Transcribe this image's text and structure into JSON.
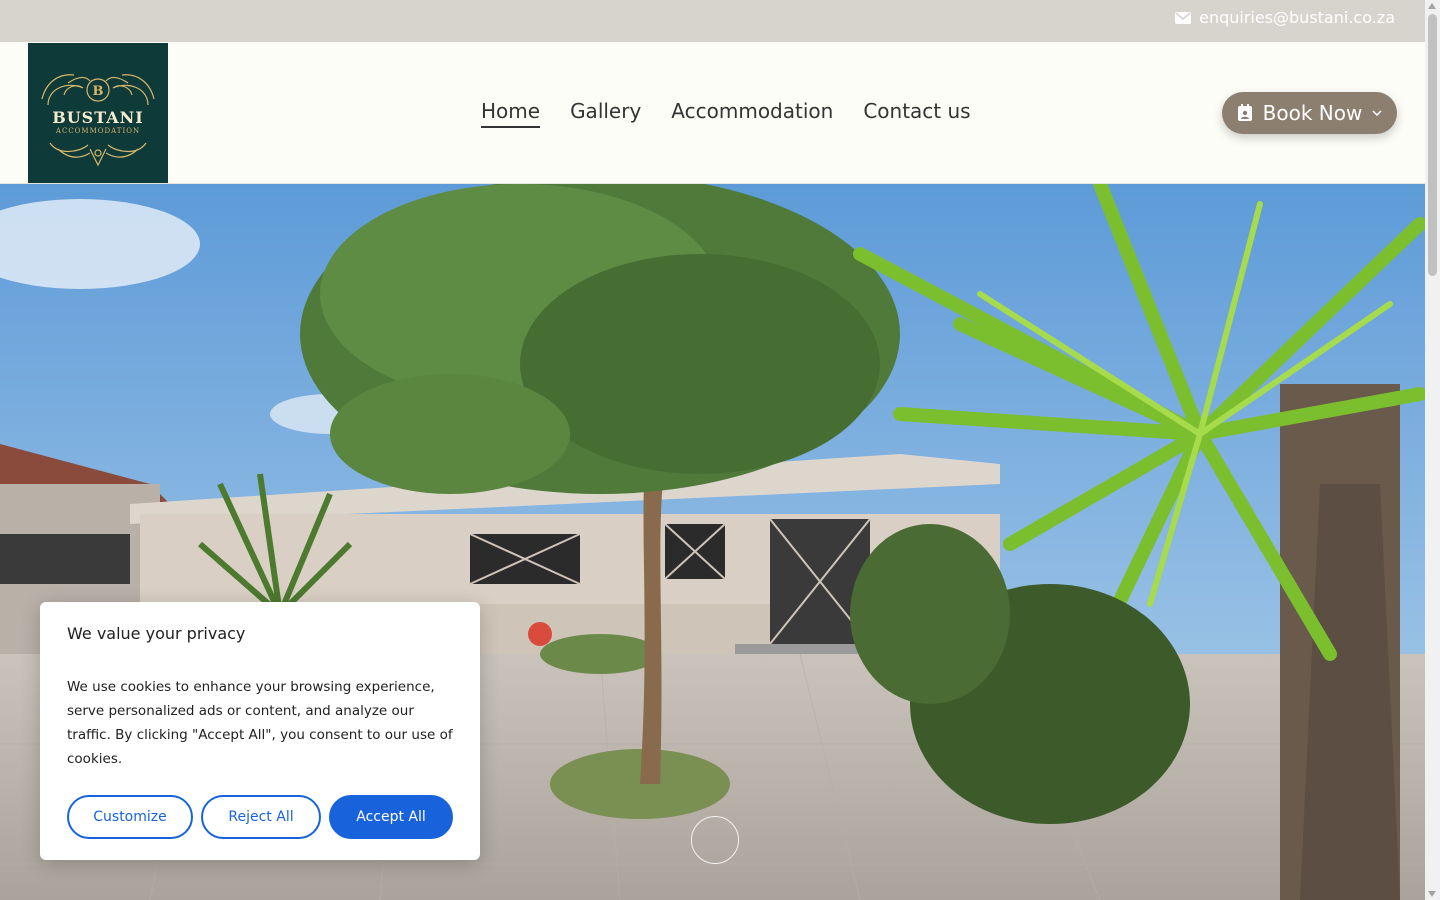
{
  "topbar": {
    "email": "enquiries@bustani.co.za",
    "icon": "envelope-icon"
  },
  "logo": {
    "name": "BUSTANI",
    "subtitle": "ACCOMMODATION",
    "monogram": "B"
  },
  "nav": {
    "items": [
      {
        "label": "Home",
        "active": true
      },
      {
        "label": "Gallery",
        "active": false
      },
      {
        "label": "Accommodation",
        "active": false
      },
      {
        "label": "Contact us",
        "active": false
      }
    ]
  },
  "book_button": {
    "label": "Book Now",
    "icon": "calendar-icon",
    "chevron": "chevron-down-icon"
  },
  "cookie_banner": {
    "title": "We value your privacy",
    "body": "We use cookies to enhance your browsing experience, serve personalized ads or content, and analyze our traffic. By clicking \"Accept All\", you consent to our use of cookies.",
    "customize_label": "Customize",
    "reject_label": "Reject All",
    "accept_label": "Accept All"
  },
  "colors": {
    "topbar": "#d7d3cd",
    "logo_bg": "#0e3a3a",
    "logo_gold": "#d9b86a",
    "book_button": "#8c7f6f",
    "cookie_accent": "#1863dc"
  }
}
